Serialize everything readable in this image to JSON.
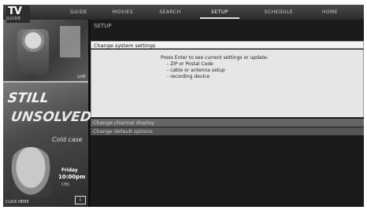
{
  "app": {
    "logo_main": "TV",
    "logo_sub": "GUIDE"
  },
  "tabs": [
    {
      "label": "GUIDE"
    },
    {
      "label": "MOVIES"
    },
    {
      "label": "SEARCH"
    },
    {
      "label": "SETUP"
    },
    {
      "label": "SCHEDULE"
    },
    {
      "label": "HOME"
    }
  ],
  "preview": {
    "badge": "LIVE"
  },
  "promo": {
    "headline_1": "STILL",
    "headline_2": "UNSOLVED",
    "show": "Cold case",
    "day": "Friday",
    "time": "10:00pm",
    "network": "CBS",
    "cta": "CLICK HERE",
    "badge": "i"
  },
  "setup": {
    "breadcrumb": "SETUP",
    "selected_item": "Change system settings",
    "intro": "Press Enter to see current settings or update:",
    "options": [
      "- ZIP or Postal Code",
      "- cable or antenna setup",
      "- recording device"
    ],
    "item_2": "Change channel display",
    "item_3": "Change default options"
  }
}
